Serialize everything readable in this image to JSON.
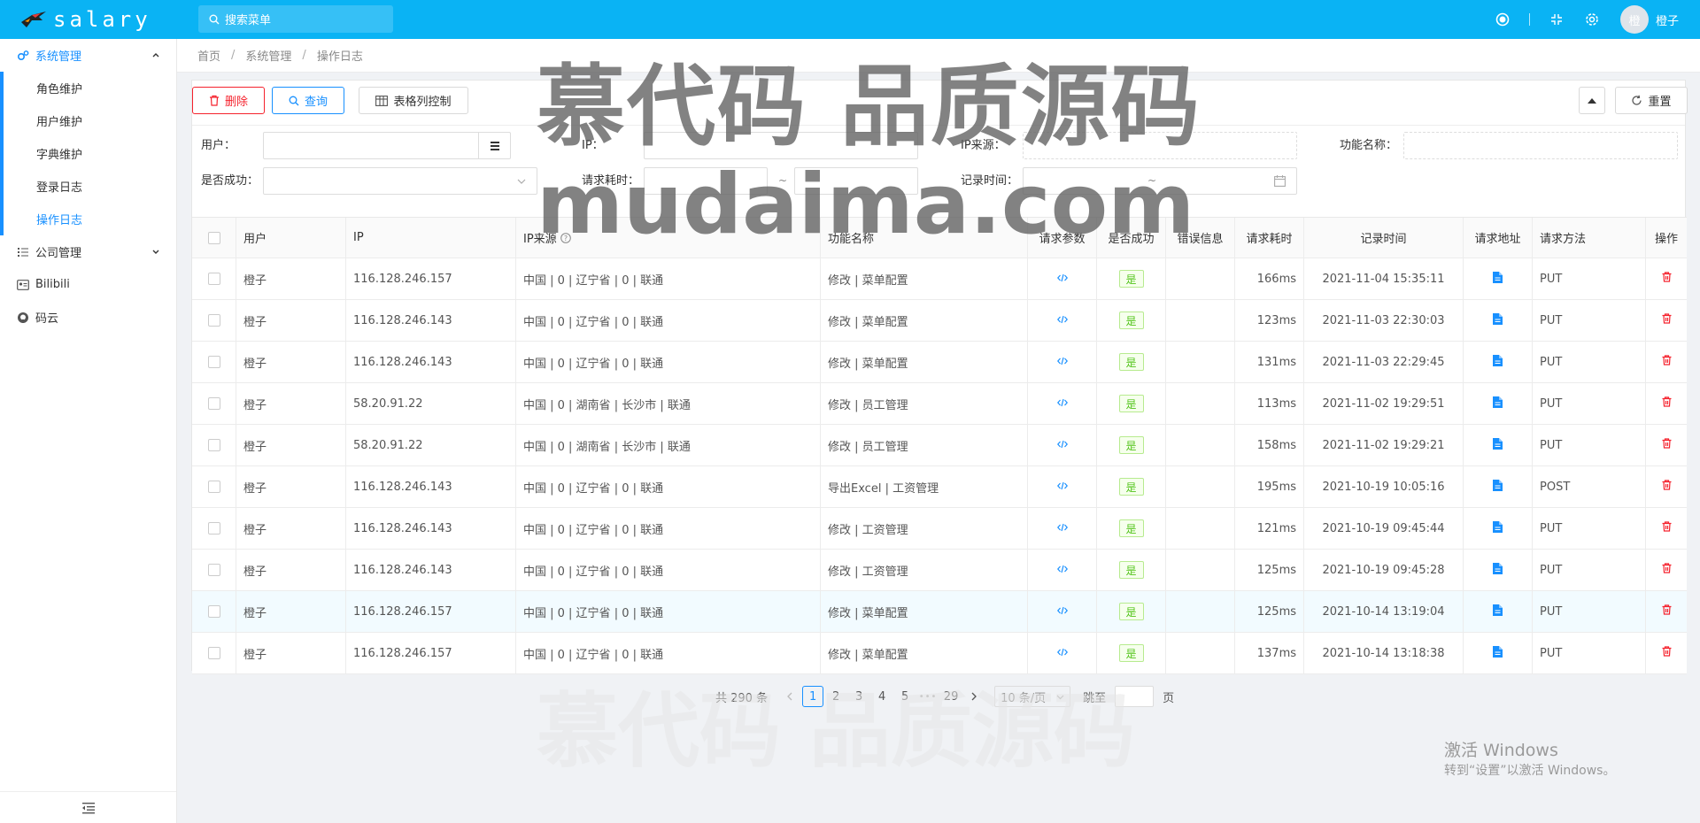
{
  "header": {
    "app_name": "salary",
    "search_placeholder": "搜索菜单",
    "avatar_text": "橙",
    "username": "橙子"
  },
  "sidebar": {
    "groups": [
      {
        "label": "系统管理",
        "icon": "gears-icon",
        "expanded": true,
        "items": [
          {
            "label": "角色维护"
          },
          {
            "label": "用户维护"
          },
          {
            "label": "字典维护"
          },
          {
            "label": "登录日志"
          },
          {
            "label": "操作日志",
            "active": true
          }
        ]
      },
      {
        "label": "公司管理",
        "icon": "list-icon",
        "expanded": false
      },
      {
        "label": "Bilibili",
        "icon": "id-card-icon"
      },
      {
        "label": "码云",
        "icon": "github-icon"
      }
    ]
  },
  "breadcrumb": [
    "首页",
    "系统管理",
    "操作日志"
  ],
  "toolbar": {
    "delete_label": "删除",
    "query_label": "查询",
    "columns_label": "表格列控制",
    "reset_label": "重置"
  },
  "filters": {
    "user_label": "用户：",
    "ip_label": "IP：",
    "ip_source_label": "IP来源：",
    "function_label": "功能名称：",
    "success_label": "是否成功：",
    "duration_label": "请求耗时：",
    "record_time_label": "记录时间：",
    "range_sep": "~"
  },
  "table": {
    "columns": [
      "用户",
      "IP",
      "IP来源",
      "功能名称",
      "请求参数",
      "是否成功",
      "错误信息",
      "请求耗时",
      "记录时间",
      "请求地址",
      "请求方法",
      "操作"
    ],
    "rows": [
      {
        "user": "橙子",
        "ip": "116.128.246.157",
        "source": "中国 | 0 | 辽宁省 | 0 | 联通",
        "func": "修改 | 菜单配置",
        "success": "是",
        "error": "",
        "duration": "166ms",
        "time": "2021-11-04 15:35:11",
        "method": "PUT"
      },
      {
        "user": "橙子",
        "ip": "116.128.246.143",
        "source": "中国 | 0 | 辽宁省 | 0 | 联通",
        "func": "修改 | 菜单配置",
        "success": "是",
        "error": "",
        "duration": "123ms",
        "time": "2021-11-03 22:30:03",
        "method": "PUT"
      },
      {
        "user": "橙子",
        "ip": "116.128.246.143",
        "source": "中国 | 0 | 辽宁省 | 0 | 联通",
        "func": "修改 | 菜单配置",
        "success": "是",
        "error": "",
        "duration": "131ms",
        "time": "2021-11-03 22:29:45",
        "method": "PUT"
      },
      {
        "user": "橙子",
        "ip": "58.20.91.22",
        "source": "中国 | 0 | 湖南省 | 长沙市 | 联通",
        "func": "修改 | 员工管理",
        "success": "是",
        "error": "",
        "duration": "113ms",
        "time": "2021-11-02 19:29:51",
        "method": "PUT"
      },
      {
        "user": "橙子",
        "ip": "58.20.91.22",
        "source": "中国 | 0 | 湖南省 | 长沙市 | 联通",
        "func": "修改 | 员工管理",
        "success": "是",
        "error": "",
        "duration": "158ms",
        "time": "2021-11-02 19:29:21",
        "method": "PUT"
      },
      {
        "user": "橙子",
        "ip": "116.128.246.143",
        "source": "中国 | 0 | 辽宁省 | 0 | 联通",
        "func": "导出Excel | 工资管理",
        "success": "是",
        "error": "",
        "duration": "195ms",
        "time": "2021-10-19 10:05:16",
        "method": "POST"
      },
      {
        "user": "橙子",
        "ip": "116.128.246.143",
        "source": "中国 | 0 | 辽宁省 | 0 | 联通",
        "func": "修改 | 工资管理",
        "success": "是",
        "error": "",
        "duration": "121ms",
        "time": "2021-10-19 09:45:44",
        "method": "PUT"
      },
      {
        "user": "橙子",
        "ip": "116.128.246.143",
        "source": "中国 | 0 | 辽宁省 | 0 | 联通",
        "func": "修改 | 工资管理",
        "success": "是",
        "error": "",
        "duration": "125ms",
        "time": "2021-10-19 09:45:28",
        "method": "PUT"
      },
      {
        "user": "橙子",
        "ip": "116.128.246.157",
        "source": "中国 | 0 | 辽宁省 | 0 | 联通",
        "func": "修改 | 菜单配置",
        "success": "是",
        "error": "",
        "duration": "125ms",
        "time": "2021-10-14 13:19:04",
        "method": "PUT",
        "highlighted": true
      },
      {
        "user": "橙子",
        "ip": "116.128.246.157",
        "source": "中国 | 0 | 辽宁省 | 0 | 联通",
        "func": "修改 | 菜单配置",
        "success": "是",
        "error": "",
        "duration": "137ms",
        "time": "2021-10-14 13:18:38",
        "method": "PUT"
      }
    ]
  },
  "pagination": {
    "total_text": "共 290 条",
    "pages": [
      "1",
      "2",
      "3",
      "4",
      "5"
    ],
    "ellipsis": "•••",
    "last_page": "29",
    "current": "1",
    "page_size": "10 条/页",
    "jump_label": "跳至",
    "page_suffix": "页"
  },
  "watermark": {
    "line1": "慕代码 品质源码",
    "line2": "mudaima.com"
  },
  "windows_activation": {
    "title": "激活 Windows",
    "subtitle": "转到“设置”以激活 Windows。"
  },
  "colors": {
    "header": "#0ab3f4",
    "accent": "#1890ff",
    "danger": "#f5222d",
    "success": "#52c41a"
  }
}
